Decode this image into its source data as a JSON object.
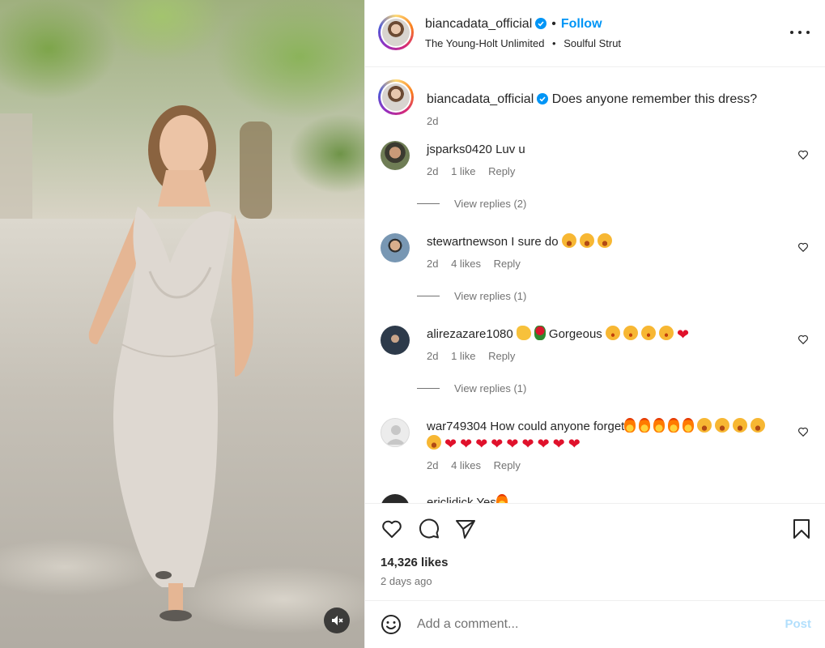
{
  "media": {
    "mute_icon": "speaker-muted-icon"
  },
  "header": {
    "username": "biancadata_official",
    "separator": "•",
    "follow_label": "Follow",
    "audio_artist": "The Young-Holt Unlimited",
    "audio_separator": "•",
    "audio_track": "Soulful Strut",
    "more_icon": "more-options-icon"
  },
  "caption": {
    "username": "biancadata_official",
    "text": "Does anyone remember this dress?",
    "time": "2d"
  },
  "comments": [
    {
      "username": "jsparks0420",
      "text": "Luv u",
      "time": "2d",
      "likes": "1 like",
      "reply": "Reply",
      "view_replies": "View replies (2)"
    },
    {
      "username": "stewartnewson",
      "text": "I sure do",
      "time": "2d",
      "likes": "4 likes",
      "reply": "Reply",
      "view_replies": "View replies (1)"
    },
    {
      "username": "alirezazare1080",
      "text": "Gorgeous",
      "time": "2d",
      "likes": "1 like",
      "reply": "Reply",
      "view_replies": "View replies (1)"
    },
    {
      "username": "war749304",
      "text": "How could anyone forget",
      "time": "2d",
      "likes": "4 likes",
      "reply": "Reply"
    },
    {
      "username": "ericlidick",
      "text": "Yes"
    }
  ],
  "actions": {
    "likes": "14,326 likes",
    "posted": "2 days ago"
  },
  "add_comment": {
    "placeholder": "Add a comment...",
    "post_label": "Post"
  },
  "colors": {
    "link_blue": "#0095f6",
    "post_disabled": "#b2dffc",
    "heart_red": "#e0112b",
    "text_primary": "#262626",
    "text_secondary": "#737373"
  }
}
